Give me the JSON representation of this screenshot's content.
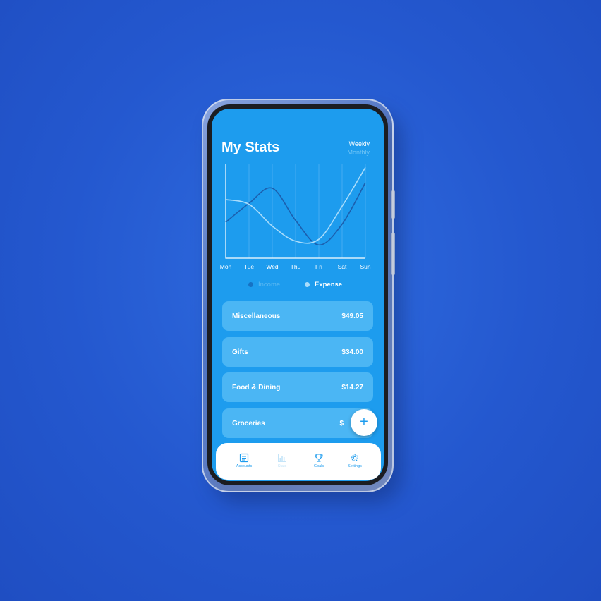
{
  "screen": {
    "title": "My Stats",
    "period_options": [
      "Weekly",
      "Monthly"
    ],
    "selected_period": "Weekly"
  },
  "chart_data": {
    "type": "line",
    "x": [
      "Mon",
      "Tue",
      "Wed",
      "Thu",
      "Fri",
      "Sat",
      "Sun"
    ],
    "series": [
      {
        "name": "Income",
        "values": [
          38,
          58,
          74,
          40,
          14,
          36,
          80
        ]
      },
      {
        "name": "Expense",
        "values": [
          62,
          57,
          34,
          18,
          20,
          55,
          96
        ]
      }
    ],
    "grid": true,
    "colors": {
      "Income": "#1c5fae",
      "Expense": "#a9dcfb"
    }
  },
  "legend": {
    "income": "Income",
    "expense": "Expense"
  },
  "categories": [
    {
      "name": "Miscellaneous",
      "amount": "$49.05"
    },
    {
      "name": "Gifts",
      "amount": "$34.00"
    },
    {
      "name": "Food & Dining",
      "amount": "$14.27"
    },
    {
      "name": "Groceries",
      "amount": "$"
    }
  ],
  "fab_label": "+",
  "nav": [
    {
      "label": "Accounts",
      "icon": "accounts-icon"
    },
    {
      "label": "Stats",
      "icon": "stats-icon"
    },
    {
      "label": "Goals",
      "icon": "trophy-icon"
    },
    {
      "label": "Settings",
      "icon": "gear-icon"
    }
  ],
  "colors": {
    "background": "#2458cf",
    "screen": "#1d9cee",
    "card": "#4bb6f4",
    "accent": "#1d9cee"
  }
}
